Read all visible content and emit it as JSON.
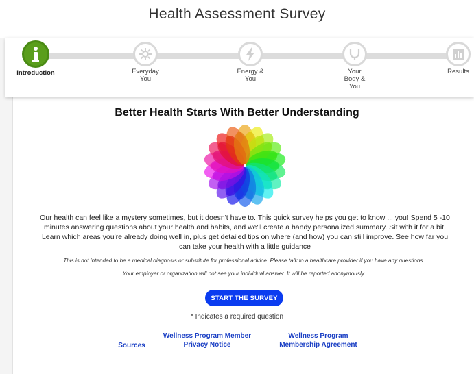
{
  "page": {
    "title": "Health Assessment Survey"
  },
  "steps": [
    {
      "label": "Introduction",
      "icon": "info-icon",
      "active": true
    },
    {
      "label": "Everyday You",
      "icon": "gear-icon",
      "active": false
    },
    {
      "label": "Energy & You",
      "icon": "lightning-icon",
      "active": false
    },
    {
      "label": "Your Body & You",
      "icon": "stethoscope-icon",
      "active": false
    },
    {
      "label": "Results",
      "icon": "bar-chart-icon",
      "active": false
    }
  ],
  "main": {
    "title": "Better Health Starts With Better Understanding",
    "intro_text": "Our health can feel like a mystery sometimes, but it doesn't have to. This quick survey helps you get to know ... you! Spend 5 -10 minutes answering questions about your health and habits, and we'll create a handy personalized summary. Sit with it for a bit. Learn which areas you're already doing well in, plus get detailed tips on where (and how) you can still improve. See how far you can take your health with a little guidance",
    "disclaimer_1": "This is not intended to be a medical diagnosis or substitute for professional advice. Please talk to a healthcare provider if you have any questions.",
    "disclaimer_2": "Your employer or organization will not see your individual answer. It will be reported anonymously.",
    "start_button": "START THE SURVEY",
    "required_note": "* Indicates a required question"
  },
  "footer": {
    "sources": "Sources",
    "privacy_line1": "Wellness Program Member",
    "privacy_line2": "Privacy Notice",
    "membership_line1": "Wellness Program",
    "membership_line2": "Membership Agreement"
  },
  "colors": {
    "accent": "#0b3cf0",
    "active_step": "#5a9e1c",
    "link": "#1a3fc4"
  }
}
